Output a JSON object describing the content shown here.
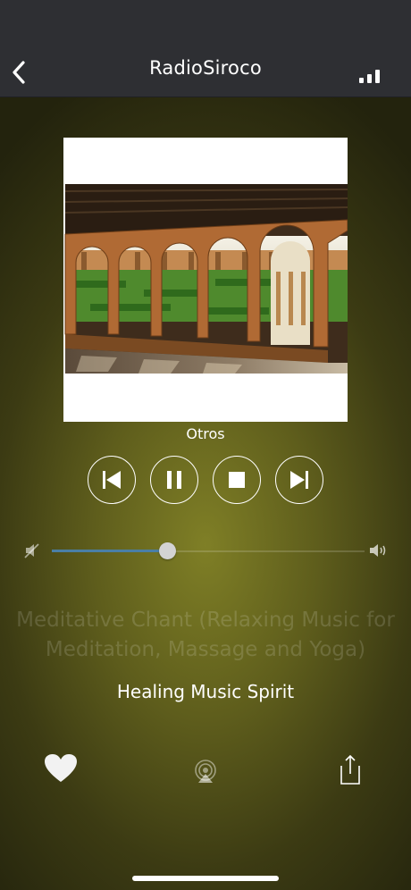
{
  "header": {
    "title": "RadioSiroco",
    "back_icon": "chevron-left-icon",
    "signal_icon": "signal-bars-icon"
  },
  "player": {
    "genre": "Otros",
    "artwork": "cloister-arches-photo",
    "controls": [
      {
        "name": "previous",
        "icon": "skip-previous-icon"
      },
      {
        "name": "pause",
        "icon": "pause-icon"
      },
      {
        "name": "stop",
        "icon": "stop-icon"
      },
      {
        "name": "next",
        "icon": "skip-next-icon"
      }
    ],
    "volume": {
      "level": 0.37,
      "min_icon": "volume-mute-icon",
      "max_icon": "volume-up-icon"
    },
    "track_title": "Meditative Chant (Relaxing Music for Meditation, Massage and Yoga)",
    "artist": "Healing Music Spirit"
  },
  "footer": {
    "favorite_icon": "heart-icon",
    "airplay_icon": "airplay-icon",
    "share_icon": "share-icon"
  },
  "colors": {
    "navbar": "#2e2f33",
    "accent": "#4a7fa6",
    "background": "#5e5d1c"
  }
}
